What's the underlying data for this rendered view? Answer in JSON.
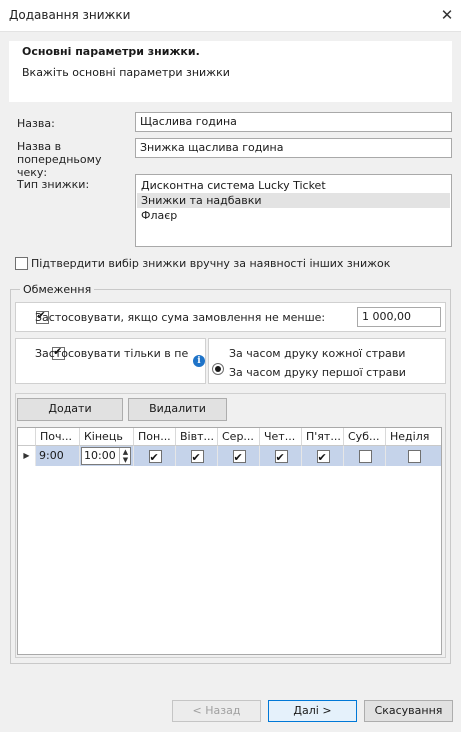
{
  "window": {
    "title": "Додавання знижки",
    "close_glyph": "✕"
  },
  "header": {
    "title": "Основні параметри знижки.",
    "subtitle": "Вкажіть основні параметри знижки"
  },
  "form": {
    "name_label": "Назва:",
    "name_value": "Щаслива година",
    "receipt_label": "Назва в попередньому чеку:",
    "receipt_value": "Знижка щаслива година",
    "type_label": "Тип знижки:",
    "type_options": [
      {
        "label": "Дисконтна система Lucky Ticket",
        "selected": false
      },
      {
        "label": "Знижки та надбавки",
        "selected": true
      },
      {
        "label": "Флаєр",
        "selected": false
      }
    ],
    "confirm_label": "Підтвердити вибір знижки вручну за наявності інших знижок",
    "confirm_checked": false
  },
  "restrictions": {
    "group_title": "Обмеження",
    "min_sum_label": "Застосовувати, якщо сума замовлення не менше:",
    "min_sum_checked": true,
    "min_sum_value": "1 000,00",
    "period_label": "Застосовувати тільки в період",
    "period_checked": true,
    "info_glyph": "i",
    "radio_each_label": "За часом друку кожної страви",
    "radio_first_label": "За часом друку першої страви",
    "radio_selected": "each"
  },
  "schedule": {
    "add_label": "Додати",
    "delete_label": "Видалити",
    "columns": [
      "Поч...",
      "Кінець",
      "Пон...",
      "Вівт...",
      "Сер...",
      "Чет...",
      "П'ят...",
      "Суб...",
      "Неділя"
    ],
    "rows": [
      {
        "start": "9:00",
        "end": "10:00",
        "days": [
          true,
          true,
          true,
          true,
          true,
          false,
          false
        ]
      }
    ]
  },
  "footer": {
    "back_label": "< Назад",
    "next_label": "Далі >",
    "cancel_label": "Скасування"
  },
  "colors": {
    "selected_row": "#c5d3ea",
    "primary_border": "#0078d7"
  }
}
